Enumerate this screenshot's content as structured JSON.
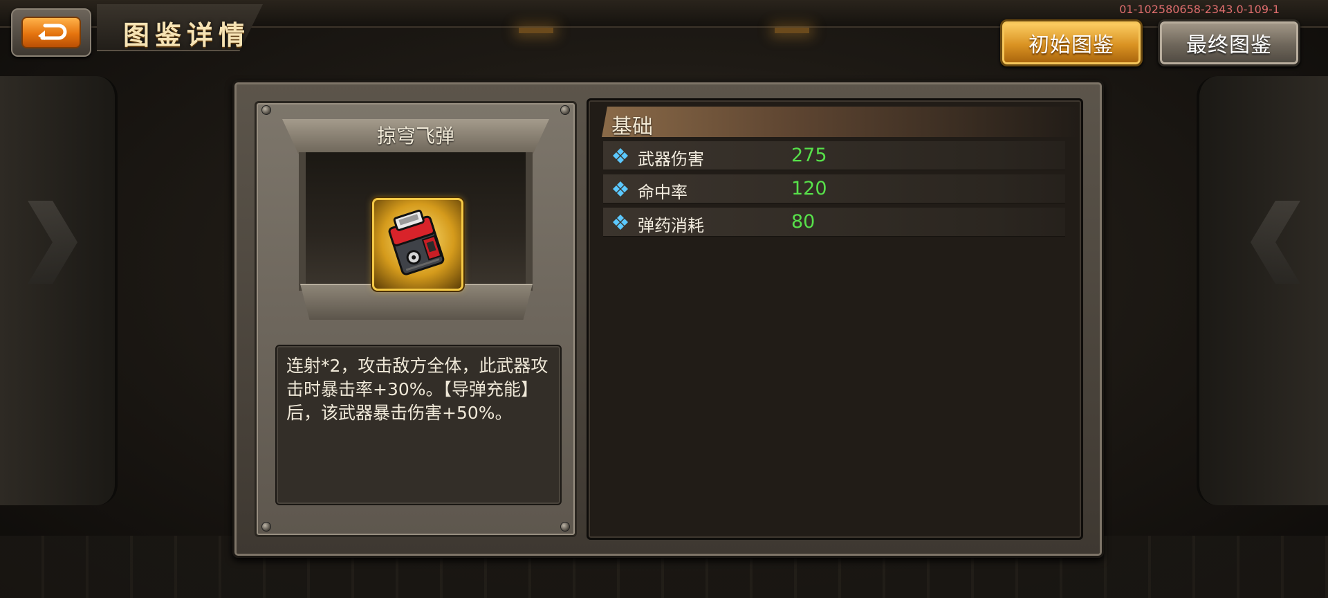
{
  "header": {
    "page_title": "图鉴详情",
    "build_id": "01-102580658-2343.0-109-1",
    "initial_button_label": "初始图鉴",
    "final_button_label": "最终图鉴"
  },
  "item": {
    "name": "掠穹飞弹",
    "description": "连射*2，攻击敌方全体，此武器攻击时暴击率+30%。【导弹充能】后，该武器暴击伤害+50%。"
  },
  "stats": {
    "section_title": "基础",
    "rows": [
      {
        "label": "武器伤害",
        "value": "275"
      },
      {
        "label": "命中率",
        "value": "120"
      },
      {
        "label": "弹药消耗",
        "value": "80"
      }
    ]
  },
  "colors": {
    "accent_orange": "#e5740e",
    "stat_value_green": "#57e04a",
    "gold_frame": "#f5c945"
  },
  "icons": {
    "back": "return-arrow-icon",
    "stat_bullet": "diamond-bullet-icon",
    "item": "missile-pod-icon"
  }
}
